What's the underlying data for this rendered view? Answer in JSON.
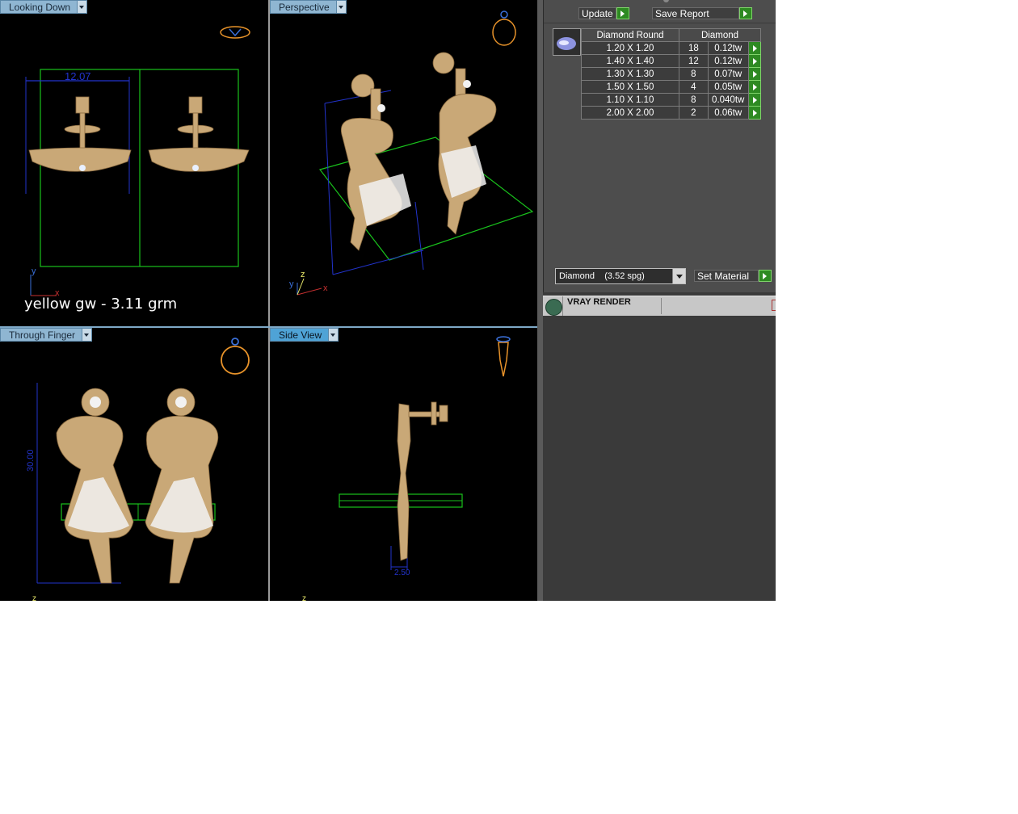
{
  "viewports": {
    "top_left": {
      "label": "Looking Down",
      "dimension": "12.07",
      "axis_y": "y",
      "axis_x": "x"
    },
    "top_right": {
      "label": "Perspective",
      "axis_y": "y",
      "axis_z": "z",
      "axis_x": "x"
    },
    "bottom_left": {
      "label": "Through Finger",
      "dimension": "30.00",
      "axis": "z"
    },
    "bottom_right": {
      "label": "Side View",
      "dimension": "2.50",
      "axis": "z"
    }
  },
  "weight_note": "yellow gw - 3.11 grm",
  "panel": {
    "update_label": "Update",
    "save_report_label": "Save Report",
    "table_headers": {
      "shape": "Diamond Round",
      "type": "Diamond"
    },
    "rows": [
      {
        "size": "1.20 X 1.20",
        "count": "18",
        "weight": "0.12tw"
      },
      {
        "size": "1.40 X 1.40",
        "count": "12",
        "weight": "0.12tw"
      },
      {
        "size": "1.30 X 1.30",
        "count": "8",
        "weight": "0.07tw"
      },
      {
        "size": "1.50 X 1.50",
        "count": "4",
        "weight": "0.05tw"
      },
      {
        "size": "1.10 X 1.10",
        "count": "8",
        "weight": "0.040tw"
      },
      {
        "size": "2.00 X 2.00",
        "count": "2",
        "weight": "0.06tw"
      }
    ],
    "material_select": "Diamond    (3.52 spg)",
    "set_material_label": "Set Material",
    "vray_title": "VRAY RENDER"
  },
  "colors": {
    "gold": "#c9a877",
    "green_box": "#19c21c",
    "blue_dim": "#2233cc",
    "active_tab": "#4fa3d6"
  }
}
